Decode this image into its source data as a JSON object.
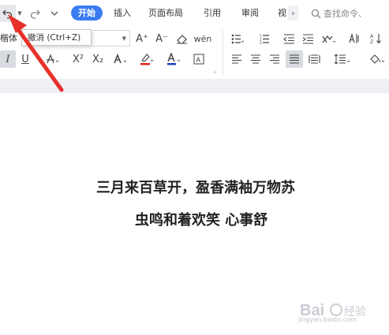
{
  "quick_access": {
    "undo_icon": "undo-icon",
    "redo_icon": "redo-icon",
    "customize_icon": "chevron-down-icon"
  },
  "tabs": [
    {
      "label": "开始",
      "active": true
    },
    {
      "label": "插入",
      "active": false
    },
    {
      "label": "页面布局",
      "active": false
    },
    {
      "label": "引用",
      "active": false
    },
    {
      "label": "审阅",
      "active": false
    },
    {
      "label": "视",
      "active": false
    }
  ],
  "search": {
    "placeholder": "查找命令、"
  },
  "tooltip": {
    "text": "撤消 (Ctrl+Z)"
  },
  "font": {
    "name": "楷体"
  },
  "toolbar": {
    "grow_font": "A⁺",
    "shrink_font": "A⁻",
    "superscript": "X²",
    "subscript": "X₂",
    "font_color_letter": "A",
    "highlight_color": "#e2231a",
    "font_color": "#1e3fbf"
  },
  "document": {
    "line1": "三月来百草开，盈香满袖万物苏",
    "line2": "虫鸣和着欢笑  心事舒"
  },
  "watermark": {
    "site": "jingyan.baidu.com"
  },
  "colors": {
    "accent": "#3a7cf0",
    "arrow": "#e8302a"
  }
}
